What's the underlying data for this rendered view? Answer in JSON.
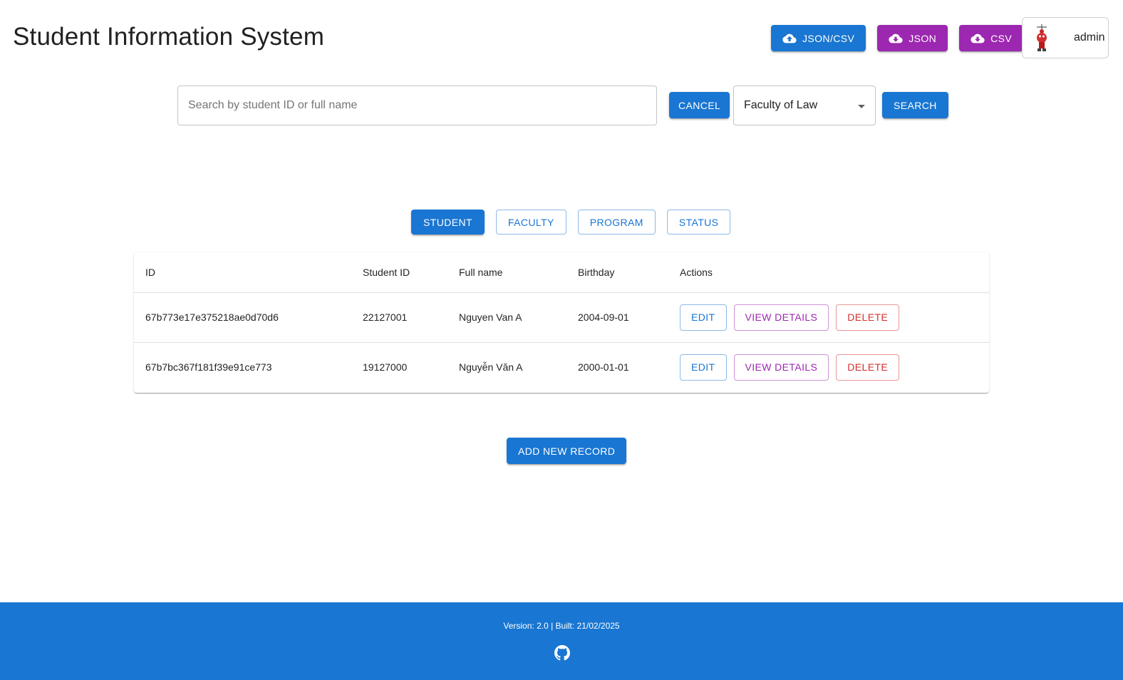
{
  "header": {
    "title": "Student Information System",
    "import_button": "JSON/CSV",
    "export_json_button": "JSON",
    "export_csv_button": "CSV",
    "username": "admin"
  },
  "search": {
    "placeholder": "Search by student ID or full name",
    "value": "",
    "cancel_label": "CANCEL",
    "faculty_selected": "Faculty of Law",
    "search_label": "SEARCH"
  },
  "tabs": [
    {
      "label": "STUDENT",
      "active": true
    },
    {
      "label": "FACULTY",
      "active": false
    },
    {
      "label": "PROGRAM",
      "active": false
    },
    {
      "label": "STATUS",
      "active": false
    }
  ],
  "table": {
    "headers": [
      "ID",
      "Student ID",
      "Full name",
      "Birthday",
      "Actions"
    ],
    "rows": [
      {
        "id": "67b773e17e375218ae0d70d6",
        "student_id": "22127001",
        "full_name": "Nguyen Van A",
        "birthday": "2004-09-01"
      },
      {
        "id": "67b7bc367f181f39e91ce773",
        "student_id": "19127000",
        "full_name": "Nguyễn Văn A",
        "birthday": "2000-01-01"
      }
    ],
    "actions": {
      "edit": "EDIT",
      "view": "VIEW DETAILS",
      "delete": "DELETE"
    }
  },
  "add_button": "ADD NEW RECORD",
  "footer": {
    "version_text": "Version: 2.0 | Built: 21/02/2025",
    "icon": "github-icon"
  },
  "colors": {
    "primary": "#1976d2",
    "secondary": "#9c27b0",
    "error": "#d32f2f"
  }
}
